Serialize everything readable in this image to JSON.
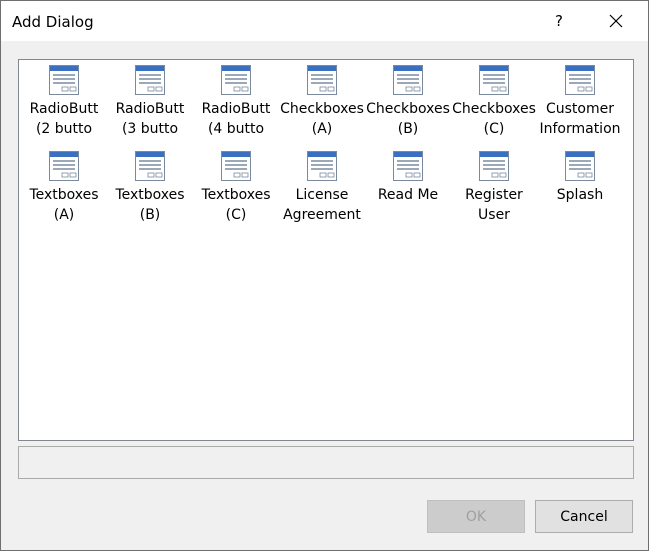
{
  "window": {
    "title": "Add Dialog",
    "help_label": "?"
  },
  "templates": [
    {
      "label": "RadioButt\n(2 butto",
      "icon": "dialog-template-icon"
    },
    {
      "label": "RadioButt\n(3 butto",
      "icon": "dialog-template-icon"
    },
    {
      "label": "RadioButt\n(4 butto",
      "icon": "dialog-template-icon"
    },
    {
      "label": "Checkboxes\n(A)",
      "icon": "dialog-template-icon"
    },
    {
      "label": "Checkboxes\n(B)",
      "icon": "dialog-template-icon"
    },
    {
      "label": "Checkboxes\n(C)",
      "icon": "dialog-template-icon"
    },
    {
      "label": "Customer\nInformation",
      "icon": "dialog-template-icon"
    },
    {
      "label": "Textboxes\n(A)",
      "icon": "dialog-template-icon"
    },
    {
      "label": "Textboxes\n(B)",
      "icon": "dialog-template-icon"
    },
    {
      "label": "Textboxes\n(C)",
      "icon": "dialog-template-icon"
    },
    {
      "label": "License\nAgreement",
      "icon": "dialog-template-icon"
    },
    {
      "label": "Read Me",
      "icon": "dialog-template-icon"
    },
    {
      "label": "Register\nUser",
      "icon": "dialog-template-icon"
    },
    {
      "label": "Splash",
      "icon": "dialog-template-icon"
    }
  ],
  "description": "",
  "buttons": {
    "ok_label": "OK",
    "ok_enabled": false,
    "cancel_label": "Cancel"
  },
  "colors": {
    "icon_title_bar": "#3b6fc0",
    "icon_frame": "#7a8a9c",
    "icon_body": "#ffffff"
  }
}
